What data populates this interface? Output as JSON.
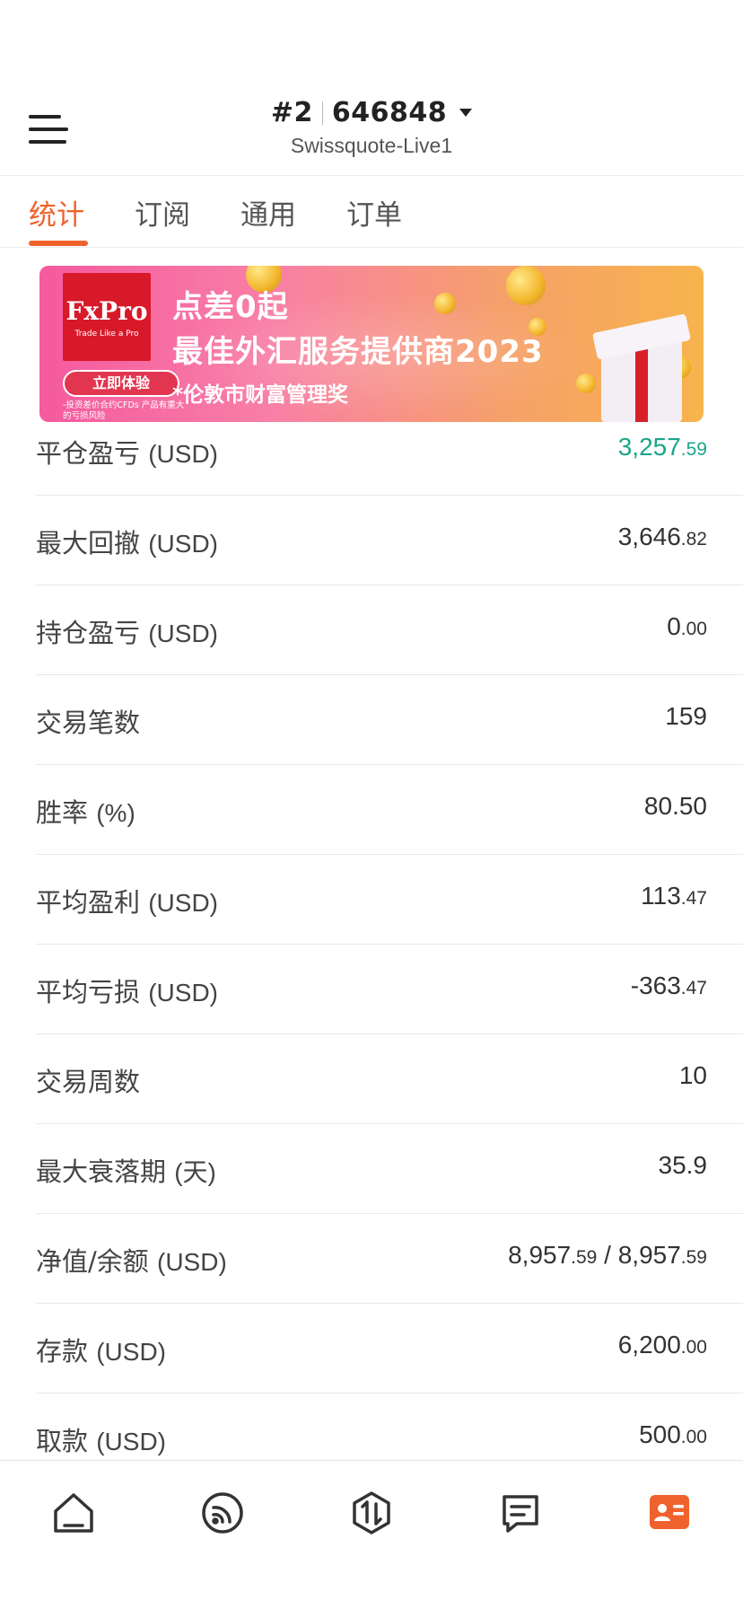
{
  "header": {
    "account_index": "#2",
    "account_number": "646848",
    "server": "Swissquote-Live1"
  },
  "tabs": [
    {
      "label": "统计",
      "active": true
    },
    {
      "label": "订阅",
      "active": false
    },
    {
      "label": "通用",
      "active": false
    },
    {
      "label": "订单",
      "active": false
    }
  ],
  "banner": {
    "logo_text": "FxPro",
    "logo_tagline": "Trade Like a Pro",
    "headline1": "点差0起",
    "headline2": "最佳外汇服务提供商2023",
    "headline3": "*伦敦市财富管理奖",
    "cta": "立即体验",
    "risk_note": "-投资差价合约CFDs 产品有重大的亏损风险"
  },
  "stats": [
    {
      "label": "平仓盈亏",
      "unit": "(USD)",
      "int": "3,257",
      "dec": ".59",
      "color": "#1aa58a"
    },
    {
      "label": "最大回撤",
      "unit": "(USD)",
      "int": "3,646",
      "dec": ".82"
    },
    {
      "label": "持仓盈亏",
      "unit": "(USD)",
      "int": "0",
      "dec": ".00"
    },
    {
      "label": "交易笔数",
      "unit": "",
      "int": "159",
      "dec": ""
    },
    {
      "label": "胜率",
      "unit": "(%)",
      "int": "80.50",
      "dec": ""
    },
    {
      "label": "平均盈利",
      "unit": "(USD)",
      "int": "113",
      "dec": ".47"
    },
    {
      "label": "平均亏损",
      "unit": "(USD)",
      "int": "-363",
      "dec": ".47"
    },
    {
      "label": "交易周数",
      "unit": "",
      "int": "10",
      "dec": ""
    },
    {
      "label": "最大衰落期",
      "unit": "(天)",
      "int": "35.9",
      "dec": ""
    },
    {
      "label": "净值/余额",
      "unit": "(USD)",
      "int": "8,957",
      "dec": ".59",
      "int2": "8,957",
      "dec2": ".59"
    },
    {
      "label": "存款",
      "unit": "(USD)",
      "int": "6,200",
      "dec": ".00"
    },
    {
      "label": "取款",
      "unit": "(USD)",
      "int": "500",
      "dec": ".00"
    }
  ],
  "bottom_nav": [
    {
      "icon": "home-icon",
      "active": false
    },
    {
      "icon": "signal-icon",
      "active": false
    },
    {
      "icon": "trade-icon",
      "active": false
    },
    {
      "icon": "message-icon",
      "active": false
    },
    {
      "icon": "profile-card-icon",
      "active": true
    }
  ],
  "colors": {
    "accent": "#f0622d",
    "positive": "#1aa58a"
  }
}
